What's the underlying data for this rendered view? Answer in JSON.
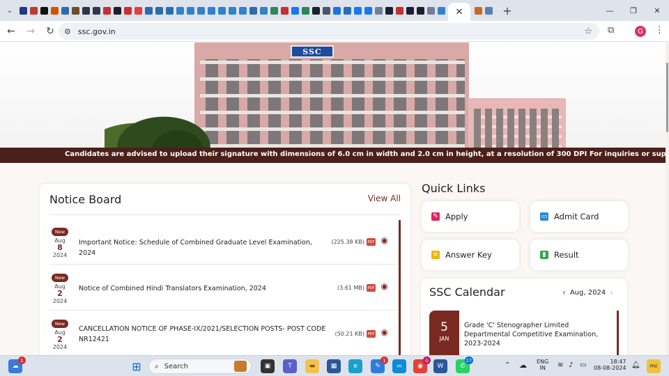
{
  "browser": {
    "active_tab_close": "✕",
    "new_tab": "+",
    "url": "ssc.gov.in",
    "profile_initial": "G",
    "favicon_colors": [
      "#1f3a8a",
      "#c0392b",
      "#111111",
      "#d35400",
      "#2b6cb0",
      "#6b4f2a",
      "#2d3748",
      "#2d3748",
      "#c53030",
      "#1a202c",
      "#c53030",
      "#e53e3e",
      "#2b6cb0",
      "#2b6cb0",
      "#2b6cb0",
      "#3182ce",
      "#3182ce",
      "#3182ce",
      "#3182ce",
      "#3182ce",
      "#3182ce",
      "#3182ce",
      "#2b6cb0",
      "#3182ce",
      "#2f855a",
      "#c53030",
      "#1877f2",
      "#2f855a",
      "#1a202c",
      "#4a5568",
      "#1a73e8",
      "#2b6cb0",
      "#1877f2",
      "#1877f2",
      "#718096",
      "#1a202c",
      "#c53030",
      "#1a202c",
      "#1a202c",
      "#718096",
      "#3182ce"
    ],
    "active_tab_favicon_color": "#c56a2a"
  },
  "hero": {
    "sign_text": "SSC"
  },
  "marquee": {
    "text": "Candidates are advised to upload their signature with dimensions of 6.0 cm in width and 2.0 cm in height, at a resolution of 300 DPI   For inquiries or support, candidates ca"
  },
  "notice_board": {
    "title": "Notice Board",
    "view_all": "View All",
    "items": [
      {
        "badge": "New",
        "month": "Aug",
        "day": "8",
        "year": "2024",
        "text": "Important Notice: Schedule of Combined Graduate Level Examination, 2024",
        "size": "(225.38 KB)",
        "pdf": "PDF"
      },
      {
        "badge": "New",
        "month": "Aug",
        "day": "2",
        "year": "2024",
        "text": "Notice of Combined Hindi Translators Examination, 2024",
        "size": "(3.61 MB)",
        "pdf": "PDF"
      },
      {
        "badge": "New",
        "month": "Aug",
        "day": "2",
        "year": "2024",
        "text": "CANCELLATION NOTICE OF PHASE-IX/2021/SELECTION POSTS- POST CODE NR12421",
        "size": "(50.21 KB)",
        "pdf": "PDF"
      }
    ]
  },
  "quick_links": {
    "title": "Quick Links",
    "items": [
      {
        "label": "Apply",
        "color": "#e0245e"
      },
      {
        "label": "Admit Card",
        "color": "#2b8ad6"
      },
      {
        "label": "Answer Key",
        "color": "#f0b400"
      },
      {
        "label": "Result",
        "color": "#2fa84f"
      }
    ]
  },
  "calendar": {
    "title": "SSC Calendar",
    "month": "Aug, 2024",
    "event": {
      "day": "5",
      "month": "JAN",
      "text": "Grade 'C' Stenographer Limited Departmental Competitive Examination, 2023-2024"
    }
  },
  "taskbar": {
    "search_placeholder": "Search",
    "widgets_badge": "1",
    "app_badge_1": "1",
    "chrome_badge": "G",
    "whatsapp_badge": "27",
    "lang_1": "ENG",
    "lang_2": "IN",
    "time": "18:47",
    "date": "08-08-2024",
    "pre_label": "PRE"
  }
}
